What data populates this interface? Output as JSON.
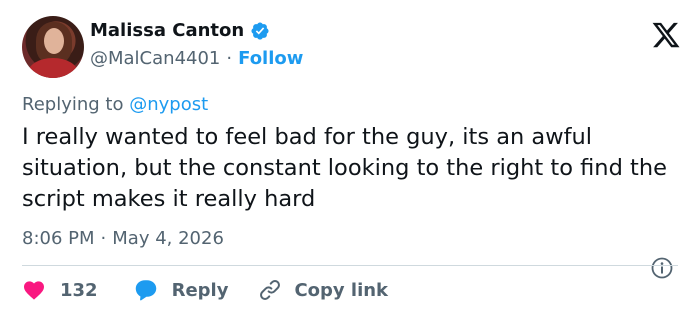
{
  "author": {
    "name": "Malissa Canton",
    "handle": "@MalCan4401",
    "separator": "·",
    "follow_label": "Follow"
  },
  "reply_context": {
    "prefix": "Replying to ",
    "mention": "@nypost"
  },
  "tweet": {
    "text": "I really wanted to feel bad for the guy, its an awful situation, but the constant looking to the right to find the script makes it really hard"
  },
  "meta": {
    "time": "8:06 PM",
    "separator": "·",
    "date": "May 4, 2026"
  },
  "actions": {
    "like_count": "132",
    "reply_label": "Reply",
    "copy_link_label": "Copy link"
  },
  "colors": {
    "accent": "#1d9bf0",
    "like": "#f91880",
    "text": "#0f1419",
    "muted": "#536471",
    "divider": "#cfd9de"
  },
  "icons": [
    "verified-badge-icon",
    "x-logo-icon",
    "info-icon",
    "heart-icon",
    "reply-bubble-icon",
    "link-icon"
  ]
}
